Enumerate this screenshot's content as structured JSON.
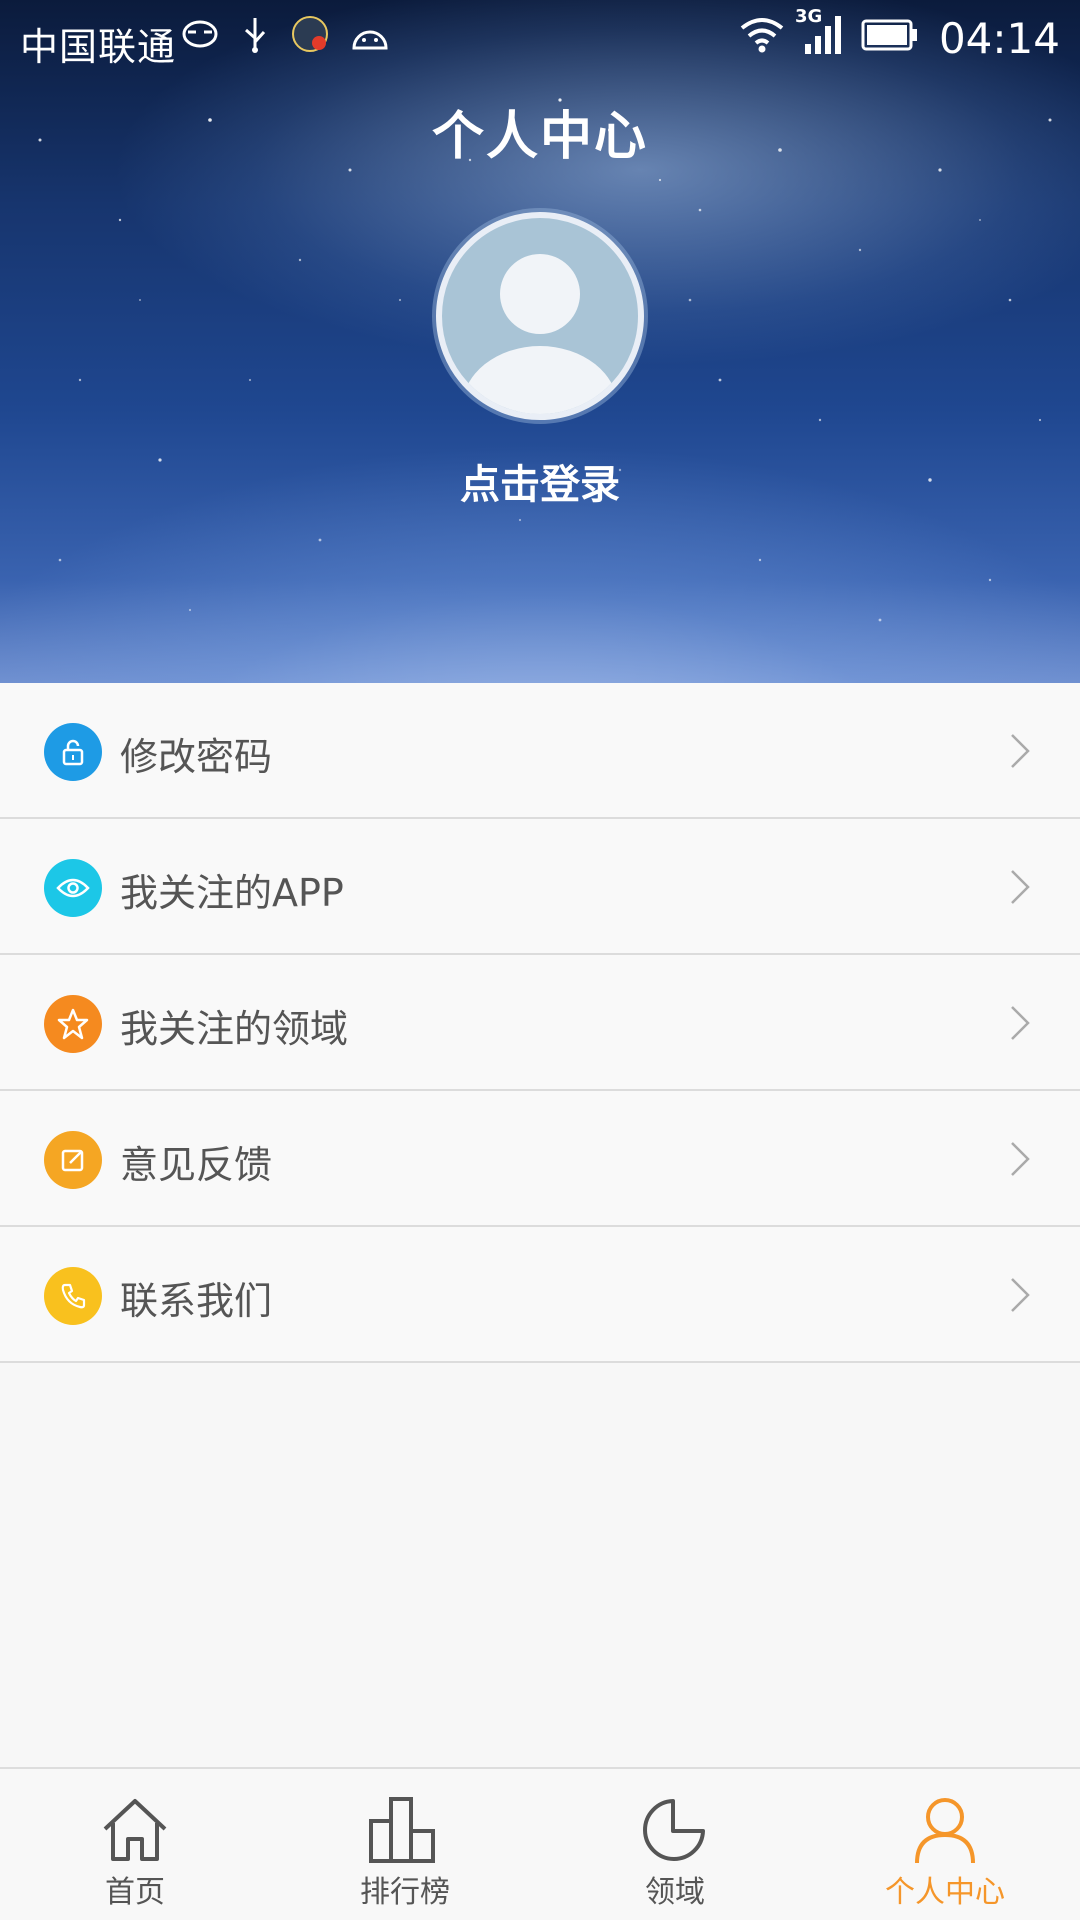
{
  "status_bar": {
    "carrier": "中国联通",
    "network": "3G",
    "time": "04:14",
    "icons_left": [
      "eye-comfort-icon",
      "usb-icon",
      "app-notification-icon",
      "android-icon"
    ],
    "icons_right": [
      "wifi-icon",
      "signal-icon",
      "battery-icon"
    ]
  },
  "header": {
    "title": "个人中心",
    "login_text": "点击登录"
  },
  "menu": {
    "items": [
      {
        "label": "修改密码",
        "icon": "lock-icon",
        "color": "#1e9be5"
      },
      {
        "label": "我关注的APP",
        "icon": "eye-icon",
        "color": "#1cc7e7"
      },
      {
        "label": "我关注的领域",
        "icon": "star-icon",
        "color": "#f58a1f"
      },
      {
        "label": "意见反馈",
        "icon": "edit-icon",
        "color": "#f5a623"
      },
      {
        "label": "联系我们",
        "icon": "phone-icon",
        "color": "#f9c11e"
      }
    ]
  },
  "bottom_nav": {
    "items": [
      {
        "label": "首页",
        "icon": "home-icon"
      },
      {
        "label": "排行榜",
        "icon": "ranking-icon"
      },
      {
        "label": "领域",
        "icon": "pie-icon"
      },
      {
        "label": "个人中心",
        "icon": "person-icon",
        "active": true
      }
    ],
    "active_color": "#f5962a",
    "inactive_color": "#555555"
  }
}
